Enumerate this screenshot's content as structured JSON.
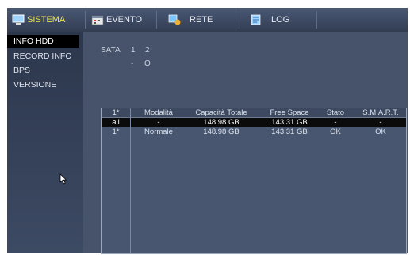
{
  "tabs": [
    {
      "label": "SISTEMA"
    },
    {
      "label": "EVENTO"
    },
    {
      "label": "RETE"
    },
    {
      "label": "LOG"
    }
  ],
  "sidebar": {
    "items": [
      {
        "label": "INFO HDD"
      },
      {
        "label": "RECORD INFO"
      },
      {
        "label": "BPS"
      },
      {
        "label": "VERSIONE"
      }
    ]
  },
  "sata": {
    "label": "SATA",
    "ports": [
      "1",
      "2"
    ],
    "status": [
      "-",
      "O"
    ]
  },
  "table": {
    "headers": [
      "1*",
      "Modalità",
      "Capacità Totale",
      "Free Space",
      "Stato",
      "S.M.A.R.T."
    ],
    "rows": [
      [
        "all",
        "-",
        "148.98 GB",
        "143.31 GB",
        "-",
        "-"
      ],
      [
        "1*",
        "Normale",
        "148.98 GB",
        "143.31 GB",
        "OK",
        "OK"
      ]
    ]
  },
  "colors": {
    "active_tab": "#f0e64c",
    "selected_row": "#0b0b0b",
    "panel": "#47536b"
  }
}
